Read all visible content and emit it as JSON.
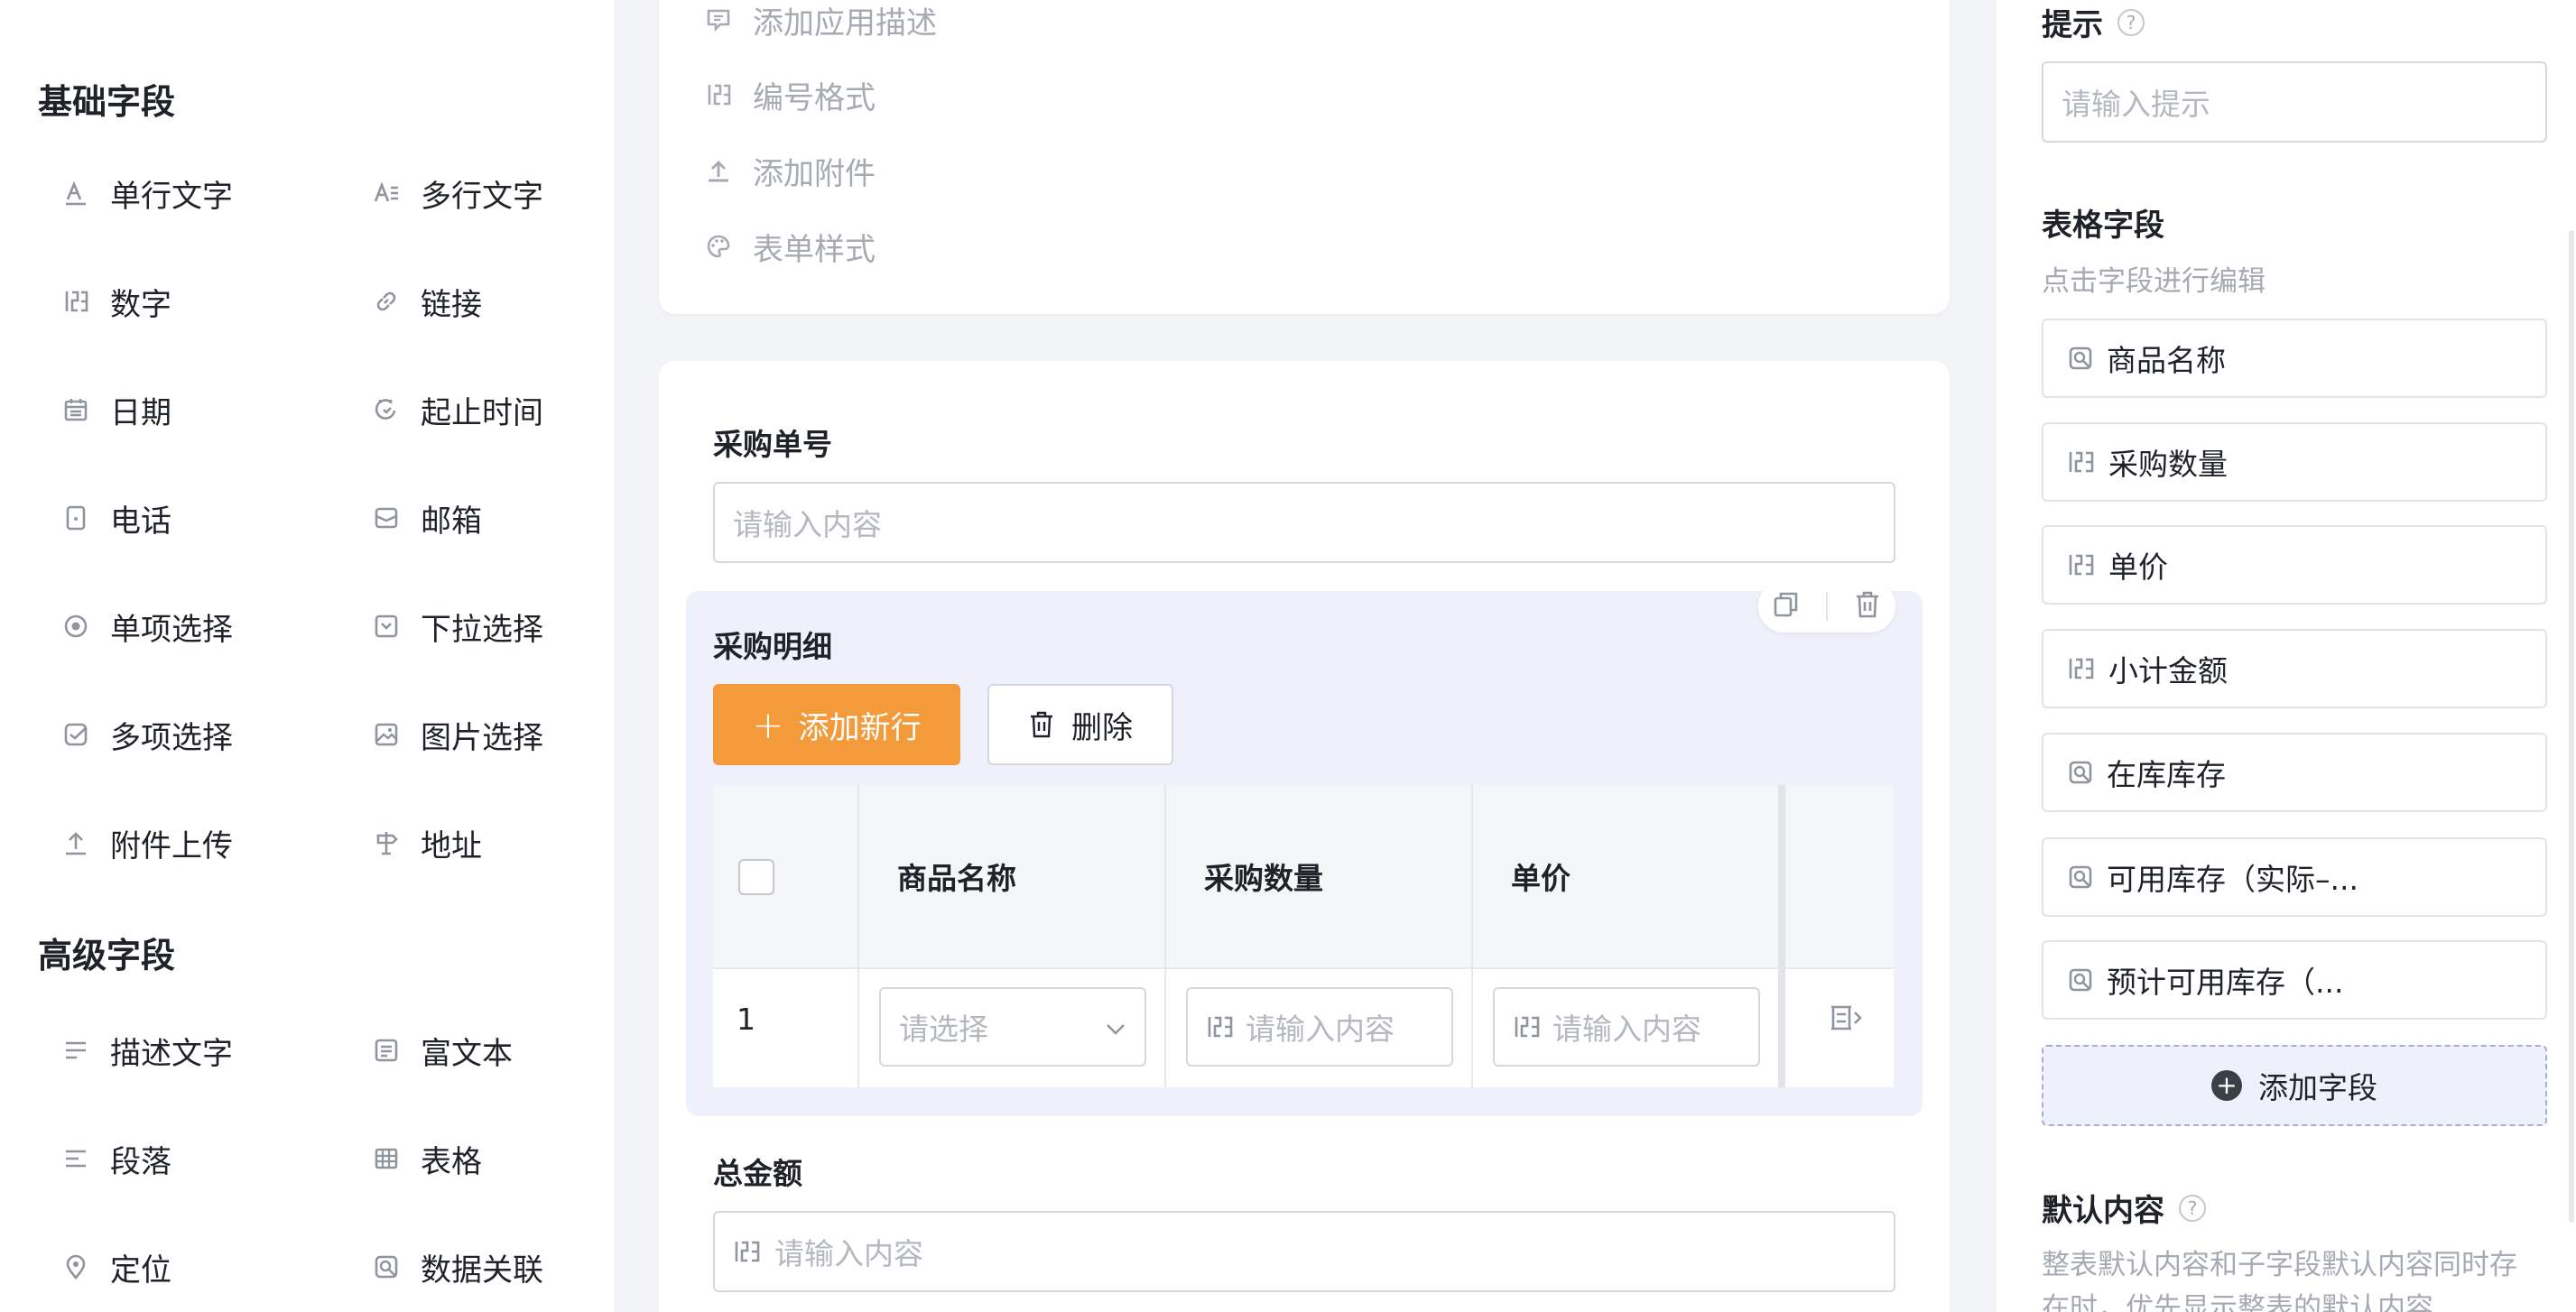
{
  "palette": {
    "basic_title": "基础字段",
    "advanced_title": "高级字段",
    "basic_items": [
      {
        "label": "单行文字",
        "icon": "single-line-text-icon"
      },
      {
        "label": "多行文字",
        "icon": "multi-line-text-icon"
      },
      {
        "label": "数字",
        "icon": "number-icon"
      },
      {
        "label": "链接",
        "icon": "link-icon"
      },
      {
        "label": "日期",
        "icon": "calendar-icon"
      },
      {
        "label": "起止时间",
        "icon": "date-range-icon"
      },
      {
        "label": "电话",
        "icon": "phone-icon"
      },
      {
        "label": "邮箱",
        "icon": "mail-icon"
      },
      {
        "label": "单项选择",
        "icon": "radio-icon"
      },
      {
        "label": "下拉选择",
        "icon": "dropdown-icon"
      },
      {
        "label": "多项选择",
        "icon": "checkbox-icon"
      },
      {
        "label": "图片选择",
        "icon": "image-icon"
      },
      {
        "label": "附件上传",
        "icon": "upload-icon"
      },
      {
        "label": "地址",
        "icon": "address-icon"
      }
    ],
    "advanced_items": [
      {
        "label": "描述文字",
        "icon": "description-icon"
      },
      {
        "label": "富文本",
        "icon": "rich-text-icon"
      },
      {
        "label": "段落",
        "icon": "paragraph-icon"
      },
      {
        "label": "表格",
        "icon": "table-icon"
      },
      {
        "label": "定位",
        "icon": "location-icon"
      },
      {
        "label": "数据关联",
        "icon": "data-link-icon"
      }
    ]
  },
  "form_settings": {
    "items": [
      {
        "label": "添加应用描述",
        "icon": "comment-icon"
      },
      {
        "label": "编号格式",
        "icon": "number-format-icon"
      },
      {
        "label": "添加附件",
        "icon": "attachment-upload-icon"
      },
      {
        "label": "表单样式",
        "icon": "palette-icon"
      }
    ]
  },
  "form": {
    "order_no": {
      "label": "采购单号",
      "placeholder": "请输入内容"
    },
    "details": {
      "label": "采购明细",
      "add_row_label": "添加新行",
      "delete_label": "删除",
      "columns": [
        "商品名称",
        "采购数量",
        "单价"
      ],
      "row": {
        "index": "1",
        "product_placeholder": "请选择",
        "qty_placeholder": "请输入内容",
        "price_placeholder": "请输入内容"
      }
    },
    "total": {
      "label": "总金额",
      "placeholder": "请输入内容"
    }
  },
  "props": {
    "hint_label": "提示",
    "hint_placeholder": "请输入提示",
    "table_fields_label": "表格字段",
    "table_fields_hint": "点击字段进行编辑",
    "table_fields": [
      {
        "label": "商品名称",
        "icon": "data-link-icon"
      },
      {
        "label": "采购数量",
        "icon": "number-icon"
      },
      {
        "label": "单价",
        "icon": "number-icon"
      },
      {
        "label": "小计金额",
        "icon": "number-icon"
      },
      {
        "label": "在库库存",
        "icon": "data-link-icon"
      },
      {
        "label": "可用库存（实际–...",
        "icon": "data-link-icon"
      },
      {
        "label": "预计可用库存（...",
        "icon": "data-link-icon"
      }
    ],
    "add_field_label": "添加字段",
    "default_label": "默认内容",
    "default_hint_line1": "整表默认内容和子字段默认内容同时存",
    "default_hint_line2": "在时，优先显示整表的默认内容"
  },
  "colors": {
    "accent": "#f39a3b",
    "block_bg": "#eef1fb",
    "muted_text": "#a6abb3"
  }
}
